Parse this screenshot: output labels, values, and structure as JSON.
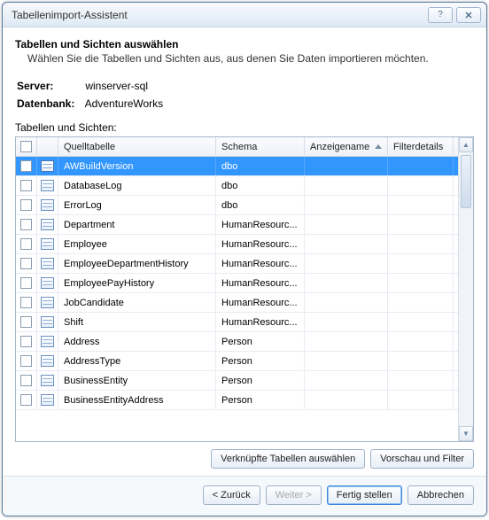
{
  "window": {
    "title": "Tabellenimport-Assistent"
  },
  "header": {
    "heading": "Tabellen und Sichten auswählen",
    "subheading": "Wählen Sie die Tabellen und Sichten aus, aus denen Sie Daten importieren möchten."
  },
  "info": {
    "server_label": "Server:",
    "server_value": "winserver-sql",
    "database_label": "Datenbank:",
    "database_value": "AdventureWorks"
  },
  "grid": {
    "label": "Tabellen und Sichten:",
    "columns": {
      "source": "Quelltabelle",
      "schema": "Schema",
      "display": "Anzeigename",
      "filter": "Filterdetails"
    },
    "rows": [
      {
        "source": "AWBuildVersion",
        "schema": "dbo",
        "display": "",
        "filter": "",
        "selected": true
      },
      {
        "source": "DatabaseLog",
        "schema": "dbo",
        "display": "",
        "filter": "",
        "selected": false
      },
      {
        "source": "ErrorLog",
        "schema": "dbo",
        "display": "",
        "filter": "",
        "selected": false
      },
      {
        "source": "Department",
        "schema": "HumanResourc...",
        "display": "",
        "filter": "",
        "selected": false
      },
      {
        "source": "Employee",
        "schema": "HumanResourc...",
        "display": "",
        "filter": "",
        "selected": false
      },
      {
        "source": "EmployeeDepartmentHistory",
        "schema": "HumanResourc...",
        "display": "",
        "filter": "",
        "selected": false
      },
      {
        "source": "EmployeePayHistory",
        "schema": "HumanResourc...",
        "display": "",
        "filter": "",
        "selected": false
      },
      {
        "source": "JobCandidate",
        "schema": "HumanResourc...",
        "display": "",
        "filter": "",
        "selected": false
      },
      {
        "source": "Shift",
        "schema": "HumanResourc...",
        "display": "",
        "filter": "",
        "selected": false
      },
      {
        "source": "Address",
        "schema": "Person",
        "display": "",
        "filter": "",
        "selected": false
      },
      {
        "source": "AddressType",
        "schema": "Person",
        "display": "",
        "filter": "",
        "selected": false
      },
      {
        "source": "BusinessEntity",
        "schema": "Person",
        "display": "",
        "filter": "",
        "selected": false
      },
      {
        "source": "BusinessEntityAddress",
        "schema": "Person",
        "display": "",
        "filter": "",
        "selected": false
      }
    ]
  },
  "buttons": {
    "select_related": "Verknüpfte Tabellen auswählen",
    "preview_filter": "Vorschau und Filter",
    "back": "< Zurück",
    "next": "Weiter >",
    "finish": "Fertig stellen",
    "cancel": "Abbrechen"
  }
}
